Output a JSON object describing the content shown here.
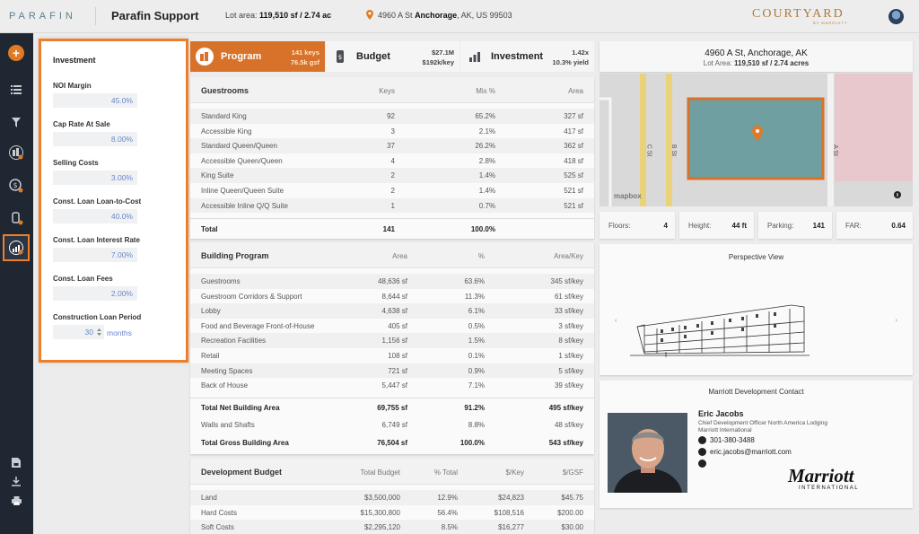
{
  "header": {
    "logo": "PARAFIN",
    "app_title": "Parafin Support",
    "lot_prefix": "Lot area:",
    "lot_value": "119,510 sf / 2.74 ac",
    "address_street": "4960 A St",
    "address_city": "Anchorage",
    "address_rest": ", AK, US 99503",
    "brand": "COURTYARD",
    "brand_sub": "BY MARRIOTT"
  },
  "investment": {
    "title": "Investment",
    "fields": [
      {
        "label": "NOI Margin",
        "value": "45.0%"
      },
      {
        "label": "Cap Rate At Sale",
        "value": "8.00%"
      },
      {
        "label": "Selling Costs",
        "value": "3.00%"
      },
      {
        "label": "Const. Loan Loan-to-Cost",
        "value": "40.0%"
      },
      {
        "label": "Const. Loan Interest Rate",
        "value": "7.00%"
      },
      {
        "label": "Const. Loan Fees",
        "value": "2.00%"
      },
      {
        "label": "Construction Loan Period",
        "value": "30",
        "unit": "months"
      }
    ]
  },
  "tabs": [
    {
      "name": "Program",
      "meta1": "141 keys",
      "meta2": "76.5k gsf",
      "active": true
    },
    {
      "name": "Budget",
      "meta1": "$27.1M",
      "meta2": "$192k/key",
      "active": false
    },
    {
      "name": "Investment",
      "meta1": "1.42x",
      "meta2": "10.3% yield",
      "active": false
    }
  ],
  "guestrooms": {
    "title": "Guestrooms",
    "cols": [
      "Keys",
      "Mix %",
      "Area"
    ],
    "rows": [
      [
        "Standard King",
        "92",
        "65.2%",
        "327 sf"
      ],
      [
        "Accessible King",
        "3",
        "2.1%",
        "417 sf"
      ],
      [
        "Standard Queen/Queen",
        "37",
        "26.2%",
        "362 sf"
      ],
      [
        "Accessible Queen/Queen",
        "4",
        "2.8%",
        "418 sf"
      ],
      [
        "King Suite",
        "2",
        "1.4%",
        "525 sf"
      ],
      [
        "Inline Queen/Queen Suite",
        "2",
        "1.4%",
        "521 sf"
      ],
      [
        "Accessible Inline Q/Q Suite",
        "1",
        "0.7%",
        "521 sf"
      ]
    ],
    "total": [
      "Total",
      "141",
      "100.0%",
      ""
    ]
  },
  "building": {
    "title": "Building Program",
    "cols": [
      "Area",
      "%",
      "Area/Key"
    ],
    "rows": [
      [
        "Guestrooms",
        "48,636 sf",
        "63.6%",
        "345 sf/key"
      ],
      [
        "Guestroom Corridors & Support",
        "8,644 sf",
        "11.3%",
        "61 sf/key"
      ],
      [
        "Lobby",
        "4,638 sf",
        "6.1%",
        "33 sf/key"
      ],
      [
        "Food and Beverage Front-of-House",
        "405 sf",
        "0.5%",
        "3 sf/key"
      ],
      [
        "Recreation Facilities",
        "1,156 sf",
        "1.5%",
        "8 sf/key"
      ],
      [
        "Retail",
        "108 sf",
        "0.1%",
        "1 sf/key"
      ],
      [
        "Meeting Spaces",
        "721 sf",
        "0.9%",
        "5 sf/key"
      ],
      [
        "Back of House",
        "5,447 sf",
        "7.1%",
        "39 sf/key"
      ]
    ],
    "net": [
      "Total Net Building Area",
      "69,755 sf",
      "91.2%",
      "495 sf/key"
    ],
    "walls": [
      "Walls and Shafts",
      "6,749 sf",
      "8.8%",
      "48 sf/key"
    ],
    "gross": [
      "Total Gross Building Area",
      "76,504 sf",
      "100.0%",
      "543 sf/key"
    ]
  },
  "budget": {
    "title": "Development Budget",
    "cols": [
      "Total Budget",
      "% Total",
      "$/Key",
      "$/GSF"
    ],
    "rows": [
      [
        "Land",
        "$3,500,000",
        "12.9%",
        "$24,823",
        "$45.75"
      ],
      [
        "Hard Costs",
        "$15,300,800",
        "56.4%",
        "$108,516",
        "$200.00"
      ],
      [
        "Soft Costs",
        "$2,295,120",
        "8.5%",
        "$16,277",
        "$30.00"
      ]
    ]
  },
  "site": {
    "title": "4960 A St, Anchorage, AK",
    "sub_prefix": "Lot Area:",
    "sub_value": "119,510 sf / 2.74 acres",
    "streets": [
      "C St",
      "B St",
      "A St"
    ],
    "map_attribution": "mapbox",
    "stats": [
      {
        "label": "Floors:",
        "value": "4"
      },
      {
        "label": "Height:",
        "value": "44 ft"
      },
      {
        "label": "Parking:",
        "value": "141"
      },
      {
        "label": "FAR:",
        "value": "0.64"
      }
    ]
  },
  "perspective": {
    "title": "Perspective View"
  },
  "contact": {
    "title": "Marriott Development Contact",
    "name": "Eric Jacobs",
    "role": "Chief Development Officer North America Lodging",
    "company": "Marriott International",
    "phone": "301-380-3488",
    "email": "eric.jacobs@marriott.com",
    "logo_main": "Marriott",
    "logo_sub": "INTERNATIONAL"
  },
  "colors": {
    "accent": "#d8722a",
    "highlight": "#ef7e2b",
    "sidebar": "#1f2732",
    "input_text": "#6a86c8"
  }
}
